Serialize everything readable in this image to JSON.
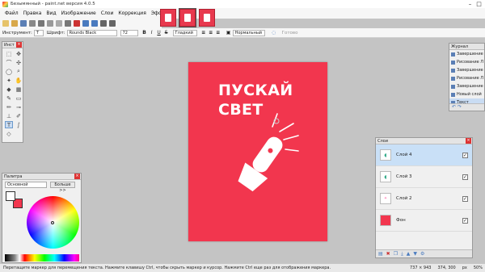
{
  "window": {
    "title": "Безымянный - paint.net версия 4.0.5"
  },
  "menu": [
    "Файл",
    "Правка",
    "Вид",
    "Изображение",
    "Слои",
    "Коррекция",
    "Эффекты"
  ],
  "options": {
    "tool_label": "Инструмент:",
    "font_label": "Шрифт:",
    "font_value": "Rounds Black",
    "size_value": "72",
    "smoothing_value": "Гладкий",
    "blend_value": "Нормальный",
    "finish_label": "Готово"
  },
  "canvas": {
    "text": "ПУСКАЙ\nСВЕТ",
    "background": "#f2364e"
  },
  "tools_panel": {
    "title": "Инст"
  },
  "palette": {
    "title": "Палитра",
    "mode": "Основной",
    "more_button": "Больше >>",
    "secondary_color": "#f2364e"
  },
  "history": {
    "title": "Журнал",
    "items": [
      "Завершение",
      "Рисование Л",
      "Завершение",
      "Рисование Л",
      "Завершение",
      "Новый слой",
      "Текст"
    ]
  },
  "layers": {
    "title": "Слои",
    "items": [
      "Слой 4",
      "Слой 3",
      "Слой 2",
      "Фон"
    ]
  },
  "status": {
    "hint": "Перетащите маркер для перемещения текста. Нажмите клавишу Ctrl, чтобы скрыть маркер и курсор. Нажмите Ctrl еще раз для отображения маркера.",
    "size": "737 × 943",
    "coords": "374, 300",
    "units": "px",
    "zoom": "50%"
  }
}
